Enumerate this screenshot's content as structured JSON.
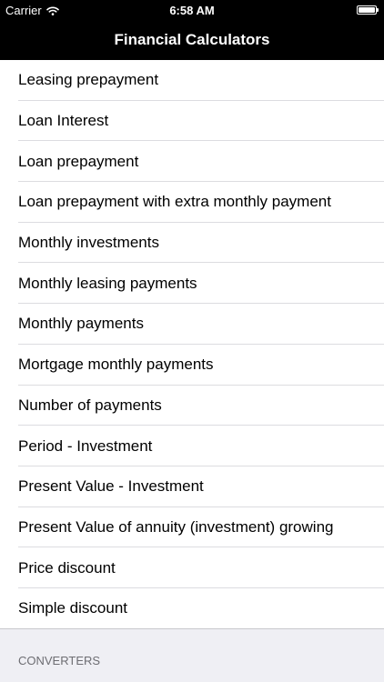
{
  "status_bar": {
    "carrier": "Carrier",
    "time": "6:58 AM"
  },
  "nav": {
    "title": "Financial Calculators"
  },
  "list": {
    "items": [
      "Leasing prepayment",
      "Loan Interest",
      "Loan prepayment",
      "Loan prepayment with extra monthly payment",
      "Monthly investments",
      "Monthly leasing payments",
      "Monthly payments",
      "Mortgage monthly payments",
      "Number of payments",
      "Period - Investment",
      "Present Value - Investment",
      "Present Value of annuity (investment) growing",
      "Price discount",
      "Simple discount"
    ]
  },
  "section": {
    "header": "CONVERTERS"
  },
  "icons": {
    "wifi": "wifi-icon",
    "battery": "battery-icon"
  },
  "colors": {
    "bar_background": "#000000",
    "bar_text": "#ffffff",
    "list_background": "#ffffff",
    "grouped_background": "#efeff4",
    "separator": "#dcdce0",
    "section_header_text": "#6d6d72"
  }
}
